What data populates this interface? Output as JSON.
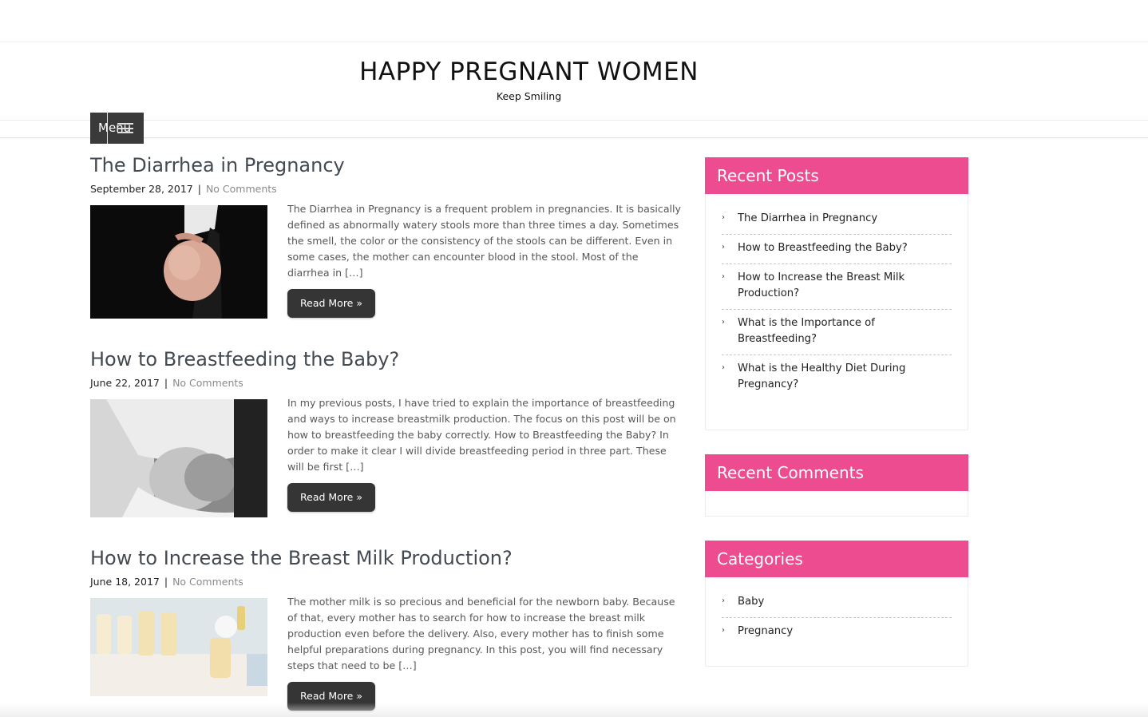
{
  "site": {
    "title": "HAPPY PREGNANT WOMEN",
    "tagline": "Keep Smiling"
  },
  "nav": {
    "menu_label": "Menu"
  },
  "colors": {
    "widget_header": "#ee4c91",
    "button": "#353535",
    "menu_bg": "#3a3a3a"
  },
  "posts": [
    {
      "title": "The Diarrhea in Pregnancy",
      "date": "September 28, 2017",
      "separator": "|",
      "comments": "No Comments",
      "excerpt": "The Diarrhea in Pregnancy is a frequent problem in pregnancies. It is basically defined as abnormally watery stools more than three times a day. Sometimes the smell, the color or the consistency of the stools can be different. Even in some cases, the mother can encounter blood in the stool. Most of the diarrhea in […]",
      "read_more": "Read More »"
    },
    {
      "title": "How to Breastfeeding the Baby?",
      "date": "June 22, 2017",
      "separator": "|",
      "comments": "No Comments",
      "excerpt": "In my previous posts, I have tried to explain the importance of breastfeeding and ways to increase breastmilk production. The focus on this post will be on how to breastfeeding the baby correctly. How to Breastfeeding the Baby? In order to make it clear I will divide breastfeeding period in three part. These will be first […]",
      "read_more": "Read More »"
    },
    {
      "title": "How to Increase the Breast Milk Production?",
      "date": "June 18, 2017",
      "separator": "|",
      "comments": "No Comments",
      "excerpt": "The mother milk is so precious and beneficial for the newborn baby. Because of that, every mother has to search for how to increase the breast milk production even before the delivery. Also, every mother has to finish some helpful preparations during pregnancy. In this post, you will find necessary steps that need to be […]",
      "read_more": "Read More »"
    }
  ],
  "sidebar": {
    "recent_posts": {
      "title": "Recent Posts",
      "items": [
        "The Diarrhea in Pregnancy",
        "How to Breastfeeding the Baby?",
        "How to Increase the Breast Milk Production?",
        "What is the Importance of Breastfeeding?",
        "What is the Healthy Diet During Pregnancy?"
      ]
    },
    "recent_comments": {
      "title": "Recent Comments"
    },
    "categories": {
      "title": "Categories",
      "items": [
        "Baby",
        "Pregnancy"
      ]
    }
  }
}
